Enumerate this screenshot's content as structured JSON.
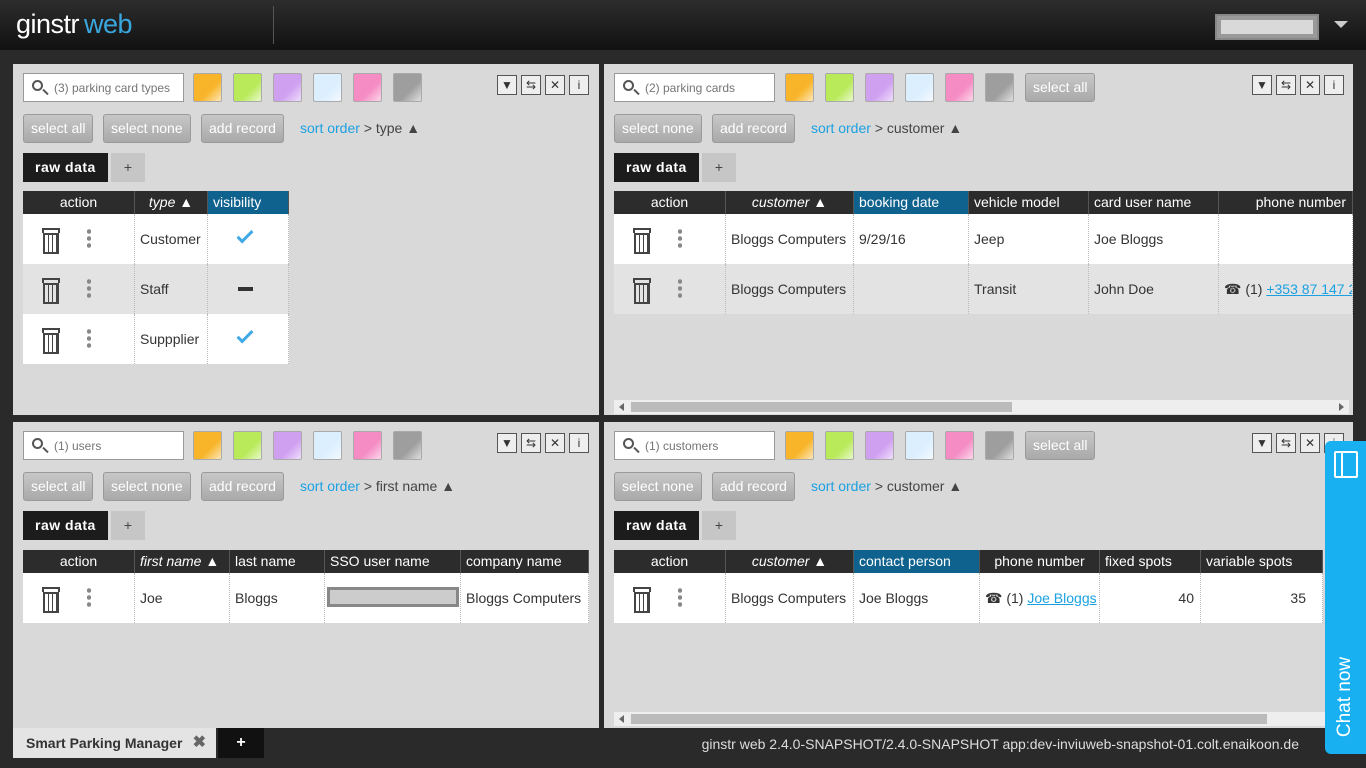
{
  "app": {
    "logo_main": "ginstr",
    "logo_sub": "web",
    "footer_tab": "Smart Parking Manager",
    "footer_tab_close": "✖",
    "footer_add": "+",
    "version": "ginstr web 2.4.0-SNAPSHOT/2.4.0-SNAPSHOT app:dev-inviuweb-snapshot-01.colt.enaikoon.de",
    "chat_label": "Chat now"
  },
  "colors": {
    "swatches": [
      "#f8b52a",
      "#b8ea5a",
      "#cf9ff0",
      "#dcefff",
      "#f58cc4",
      "#9e9e9e"
    ],
    "accent": "#1ba1e2",
    "header_selected": "#10628e"
  },
  "common": {
    "select_all": "select all",
    "select_none": "select none",
    "add_record": "add record",
    "sort_order": "sort order",
    "raw_data": "raw data",
    "tab_plus": "+",
    "ctrl_filter": "▼",
    "ctrl_swap": "⇆",
    "ctrl_close": "✕",
    "ctrl_info": "i",
    "phone_prefix": "☎ (1)"
  },
  "panels": {
    "card_types": {
      "placeholder": "(3) parking card types",
      "sort_field": "> type ▲",
      "headers": [
        "action",
        "type ▲",
        "visibility"
      ],
      "rows": [
        {
          "type": "Customer",
          "visibility": "check"
        },
        {
          "type": "Staff",
          "visibility": "dash"
        },
        {
          "type": "Suppplier",
          "visibility": "check"
        }
      ]
    },
    "parking_cards": {
      "placeholder": "(2) parking cards",
      "sort_field": "> customer ▲",
      "headers": [
        "action",
        "customer ▲",
        "booking date",
        "vehicle model",
        "card user name",
        "phone number"
      ],
      "rows": [
        {
          "customer": "Bloggs Computers",
          "booking_date": "9/29/16",
          "vehicle": "Jeep",
          "card_user": "Joe Bloggs",
          "phone": ""
        },
        {
          "customer": "Bloggs Computers",
          "booking_date": "",
          "vehicle": "Transit",
          "card_user": "John Doe",
          "phone": "+353 87 147 2"
        }
      ]
    },
    "users": {
      "placeholder": "(1) users",
      "sort_field": "> first name ▲",
      "headers": [
        "action",
        "first name ▲",
        "last name",
        "SSO user name",
        "company name"
      ],
      "rows": [
        {
          "first": "Joe",
          "last": "Bloggs",
          "company": "Bloggs Computers"
        }
      ]
    },
    "customers": {
      "placeholder": "(1) customers",
      "sort_field": "> customer ▲",
      "headers": [
        "action",
        "customer ▲",
        "contact person",
        "phone number",
        "fixed spots",
        "variable spots"
      ],
      "rows": [
        {
          "customer": "Bloggs Computers",
          "contact": "Joe Bloggs",
          "phone": "Joe Bloggs",
          "fixed": "40",
          "variable": "35"
        }
      ]
    }
  }
}
